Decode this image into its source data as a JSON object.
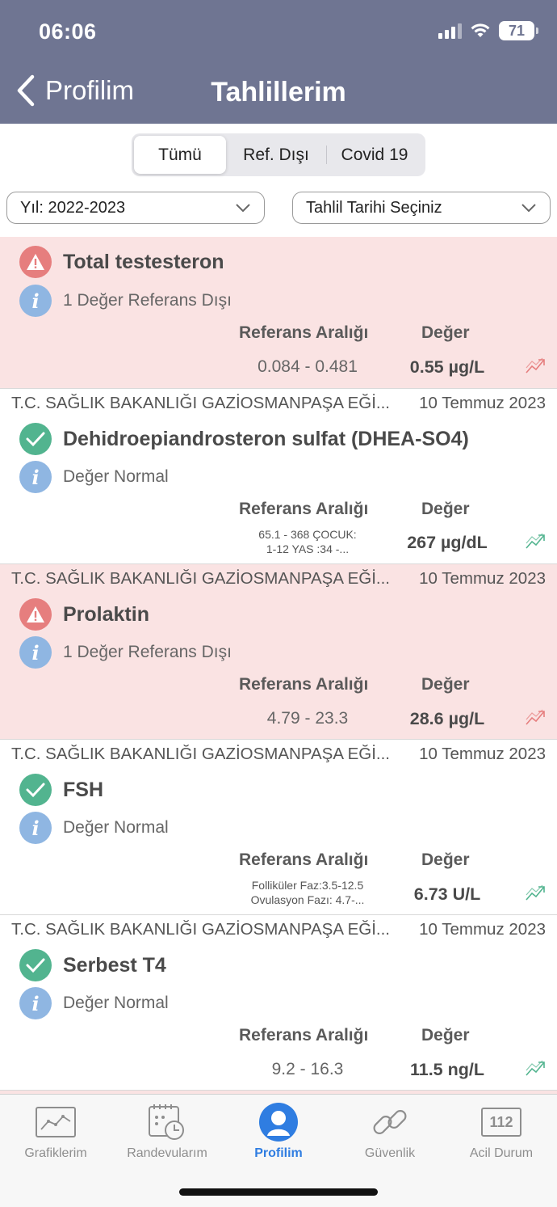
{
  "status": {
    "time": "06:06",
    "battery": "71"
  },
  "nav": {
    "back_label": "Profilim",
    "title": "Tahlillerim"
  },
  "segments": [
    "Tümü",
    "Ref. Dışı",
    "Covid 19"
  ],
  "filters": {
    "year": "Yıl: 2022-2023",
    "date": "Tahlil Tarihi Seçiniz"
  },
  "columns": {
    "ref": "Referans Aralığı",
    "value": "Değer"
  },
  "results": [
    {
      "status": "abnormal",
      "hospital": "",
      "date": "",
      "name": "Total testesteron",
      "info": "1 Değer Referans Dışı",
      "ref": "0.084 - 0.481",
      "value": "0.55 µg/L"
    },
    {
      "status": "normal",
      "hospital": "T.C. SAĞLIK BAKANLIĞI GAZİOSMANPAŞA EĞİ...",
      "date": "10 Temmuz 2023",
      "name": "Dehidroepiandrosteron sulfat (DHEA-SO4)",
      "info": "Değer Normal",
      "ref_line1": "65.1 - 368    ÇOCUK:",
      "ref_line2": "1-12  YAS          :34 -...",
      "value": "267 µg/dL"
    },
    {
      "status": "abnormal",
      "hospital": "T.C. SAĞLIK BAKANLIĞI GAZİOSMANPAŞA EĞİ...",
      "date": "10 Temmuz 2023",
      "name": "Prolaktin",
      "info": "1 Değer Referans Dışı",
      "ref": "4.79 - 23.3",
      "value": "28.6 µg/L"
    },
    {
      "status": "normal",
      "hospital": "T.C. SAĞLIK BAKANLIĞI GAZİOSMANPAŞA EĞİ...",
      "date": "10 Temmuz 2023",
      "name": "FSH",
      "info": "Değer Normal",
      "ref_line1": "Folliküler Faz:3.5-12.5",
      "ref_line2": "Ovulasyon Fazı: 4.7-...",
      "value": "6.73 U/L"
    },
    {
      "status": "normal",
      "hospital": "T.C. SAĞLIK BAKANLIĞI GAZİOSMANPAŞA EĞİ...",
      "date": "10 Temmuz 2023",
      "name": "Serbest T4",
      "info": "Değer Normal",
      "ref": "9.2 - 16.3",
      "value": "11.5 ng/L"
    }
  ],
  "tabs": [
    {
      "label": "Grafiklerim",
      "icon": "chart-icon"
    },
    {
      "label": "Randevularım",
      "icon": "calendar-clock-icon"
    },
    {
      "label": "Profilim",
      "icon": "person-icon"
    },
    {
      "label": "Güvenlik",
      "icon": "link-icon"
    },
    {
      "label": "Acil Durum",
      "icon": "emergency-112-icon",
      "icon_text": "112"
    }
  ],
  "colors": {
    "header": "#6f7592",
    "abnormal_bg": "#fae3e3",
    "warn": "#e67e7e",
    "ok": "#52b48f",
    "active_tab": "#2f7de1"
  }
}
